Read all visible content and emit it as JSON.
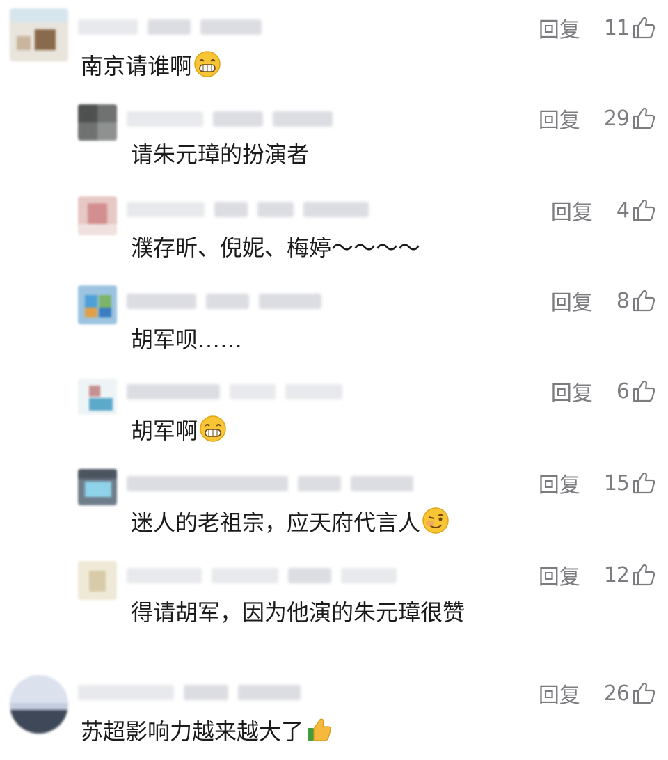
{
  "reply_label": "回复",
  "comments": [
    {
      "text": "南京请谁啊",
      "likes": "11",
      "emoji": "grin-emoji"
    },
    {
      "text": "请朱元璋的扮演者",
      "likes": "29",
      "emoji": ""
    },
    {
      "text": "濮存昕、倪妮、梅婷～～～～",
      "likes": "4",
      "emoji": ""
    },
    {
      "text": "胡军呗……",
      "likes": "8",
      "emoji": ""
    },
    {
      "text": "胡军啊",
      "likes": "6",
      "emoji": "grin-emoji"
    },
    {
      "text": "迷人的老祖宗，应天府代言人",
      "likes": "15",
      "emoji": "wink-emoji"
    },
    {
      "text": "得请胡军，因为他演的朱元璋很赞",
      "likes": "12",
      "emoji": ""
    },
    {
      "text": "苏超影响力越来越大了",
      "likes": "26",
      "emoji": "thumbs-up-emoji"
    }
  ],
  "colors": {
    "text": "#1b1b1b",
    "muted": "#7b7b80",
    "placeholder": "#dcdde2"
  }
}
